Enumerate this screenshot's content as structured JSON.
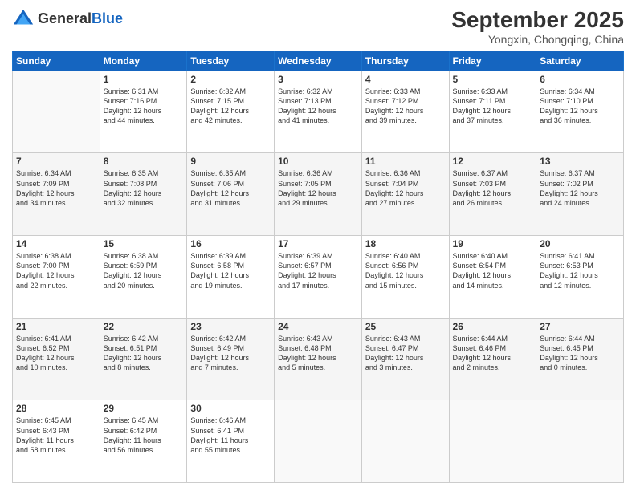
{
  "header": {
    "logo_line1": "General",
    "logo_line2": "Blue",
    "month": "September 2025",
    "location": "Yongxin, Chongqing, China"
  },
  "days_of_week": [
    "Sunday",
    "Monday",
    "Tuesday",
    "Wednesday",
    "Thursday",
    "Friday",
    "Saturday"
  ],
  "weeks": [
    [
      {
        "day": "",
        "info": ""
      },
      {
        "day": "1",
        "info": "Sunrise: 6:31 AM\nSunset: 7:16 PM\nDaylight: 12 hours\nand 44 minutes."
      },
      {
        "day": "2",
        "info": "Sunrise: 6:32 AM\nSunset: 7:15 PM\nDaylight: 12 hours\nand 42 minutes."
      },
      {
        "day": "3",
        "info": "Sunrise: 6:32 AM\nSunset: 7:13 PM\nDaylight: 12 hours\nand 41 minutes."
      },
      {
        "day": "4",
        "info": "Sunrise: 6:33 AM\nSunset: 7:12 PM\nDaylight: 12 hours\nand 39 minutes."
      },
      {
        "day": "5",
        "info": "Sunrise: 6:33 AM\nSunset: 7:11 PM\nDaylight: 12 hours\nand 37 minutes."
      },
      {
        "day": "6",
        "info": "Sunrise: 6:34 AM\nSunset: 7:10 PM\nDaylight: 12 hours\nand 36 minutes."
      }
    ],
    [
      {
        "day": "7",
        "info": "Sunrise: 6:34 AM\nSunset: 7:09 PM\nDaylight: 12 hours\nand 34 minutes."
      },
      {
        "day": "8",
        "info": "Sunrise: 6:35 AM\nSunset: 7:08 PM\nDaylight: 12 hours\nand 32 minutes."
      },
      {
        "day": "9",
        "info": "Sunrise: 6:35 AM\nSunset: 7:06 PM\nDaylight: 12 hours\nand 31 minutes."
      },
      {
        "day": "10",
        "info": "Sunrise: 6:36 AM\nSunset: 7:05 PM\nDaylight: 12 hours\nand 29 minutes."
      },
      {
        "day": "11",
        "info": "Sunrise: 6:36 AM\nSunset: 7:04 PM\nDaylight: 12 hours\nand 27 minutes."
      },
      {
        "day": "12",
        "info": "Sunrise: 6:37 AM\nSunset: 7:03 PM\nDaylight: 12 hours\nand 26 minutes."
      },
      {
        "day": "13",
        "info": "Sunrise: 6:37 AM\nSunset: 7:02 PM\nDaylight: 12 hours\nand 24 minutes."
      }
    ],
    [
      {
        "day": "14",
        "info": "Sunrise: 6:38 AM\nSunset: 7:00 PM\nDaylight: 12 hours\nand 22 minutes."
      },
      {
        "day": "15",
        "info": "Sunrise: 6:38 AM\nSunset: 6:59 PM\nDaylight: 12 hours\nand 20 minutes."
      },
      {
        "day": "16",
        "info": "Sunrise: 6:39 AM\nSunset: 6:58 PM\nDaylight: 12 hours\nand 19 minutes."
      },
      {
        "day": "17",
        "info": "Sunrise: 6:39 AM\nSunset: 6:57 PM\nDaylight: 12 hours\nand 17 minutes."
      },
      {
        "day": "18",
        "info": "Sunrise: 6:40 AM\nSunset: 6:56 PM\nDaylight: 12 hours\nand 15 minutes."
      },
      {
        "day": "19",
        "info": "Sunrise: 6:40 AM\nSunset: 6:54 PM\nDaylight: 12 hours\nand 14 minutes."
      },
      {
        "day": "20",
        "info": "Sunrise: 6:41 AM\nSunset: 6:53 PM\nDaylight: 12 hours\nand 12 minutes."
      }
    ],
    [
      {
        "day": "21",
        "info": "Sunrise: 6:41 AM\nSunset: 6:52 PM\nDaylight: 12 hours\nand 10 minutes."
      },
      {
        "day": "22",
        "info": "Sunrise: 6:42 AM\nSunset: 6:51 PM\nDaylight: 12 hours\nand 8 minutes."
      },
      {
        "day": "23",
        "info": "Sunrise: 6:42 AM\nSunset: 6:49 PM\nDaylight: 12 hours\nand 7 minutes."
      },
      {
        "day": "24",
        "info": "Sunrise: 6:43 AM\nSunset: 6:48 PM\nDaylight: 12 hours\nand 5 minutes."
      },
      {
        "day": "25",
        "info": "Sunrise: 6:43 AM\nSunset: 6:47 PM\nDaylight: 12 hours\nand 3 minutes."
      },
      {
        "day": "26",
        "info": "Sunrise: 6:44 AM\nSunset: 6:46 PM\nDaylight: 12 hours\nand 2 minutes."
      },
      {
        "day": "27",
        "info": "Sunrise: 6:44 AM\nSunset: 6:45 PM\nDaylight: 12 hours\nand 0 minutes."
      }
    ],
    [
      {
        "day": "28",
        "info": "Sunrise: 6:45 AM\nSunset: 6:43 PM\nDaylight: 11 hours\nand 58 minutes."
      },
      {
        "day": "29",
        "info": "Sunrise: 6:45 AM\nSunset: 6:42 PM\nDaylight: 11 hours\nand 56 minutes."
      },
      {
        "day": "30",
        "info": "Sunrise: 6:46 AM\nSunset: 6:41 PM\nDaylight: 11 hours\nand 55 minutes."
      },
      {
        "day": "",
        "info": ""
      },
      {
        "day": "",
        "info": ""
      },
      {
        "day": "",
        "info": ""
      },
      {
        "day": "",
        "info": ""
      }
    ]
  ]
}
